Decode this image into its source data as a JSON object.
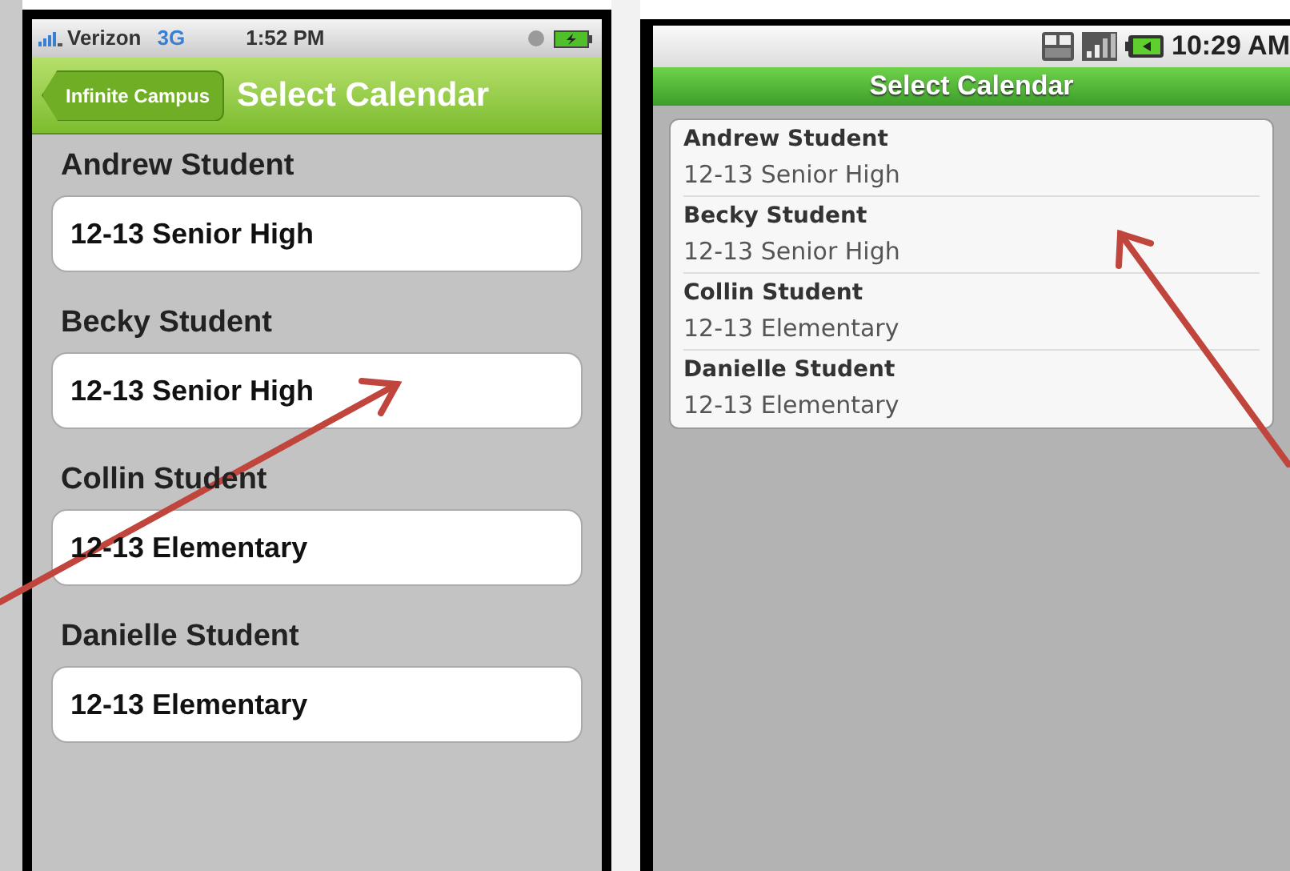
{
  "iphone": {
    "status_bar": {
      "carrier": "Verizon",
      "network": "3G",
      "time": "1:52 PM"
    },
    "nav_bar": {
      "back_button": "Infinite Campus",
      "title": "Select Calendar"
    },
    "groups": [
      {
        "name": "Andrew Student",
        "calendar": "12-13 Senior High"
      },
      {
        "name": "Becky Student",
        "calendar": "12-13 Senior High"
      },
      {
        "name": "Collin Student",
        "calendar": "12-13 Elementary"
      },
      {
        "name": "Danielle Student",
        "calendar": "12-13 Elementary"
      }
    ]
  },
  "android": {
    "status_bar": {
      "time": "10:29 AM"
    },
    "title": "Select Calendar",
    "items": [
      {
        "name": "Andrew Student",
        "calendar": "12-13 Senior High"
      },
      {
        "name": "Becky Student",
        "calendar": "12-13 Senior High"
      },
      {
        "name": "Collin Student",
        "calendar": "12-13 Elementary"
      },
      {
        "name": "Danielle Student",
        "calendar": "12-13 Elementary"
      }
    ]
  }
}
